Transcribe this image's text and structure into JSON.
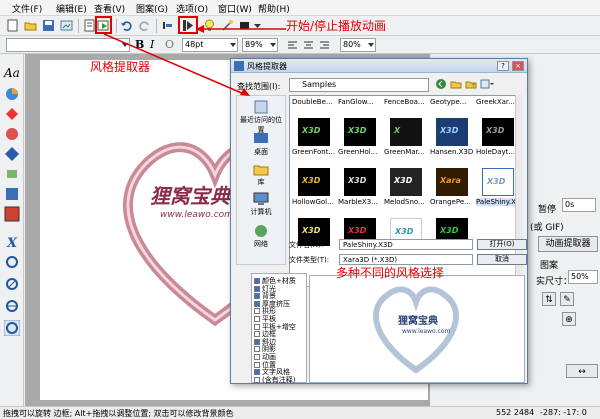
{
  "menu": [
    {
      "label": "文件(F)"
    },
    {
      "label": "编辑(E)"
    },
    {
      "label": "查看(V)"
    },
    {
      "label": "图案(G)"
    },
    {
      "label": "选项(O)"
    },
    {
      "label": "窗口(W)"
    },
    {
      "label": "帮助(H)"
    }
  ],
  "toolbar2": {
    "font_size": "48pt",
    "zoom1": "89%",
    "zoom2": "80%",
    "bold": "B",
    "italic": "I",
    "outline": "O"
  },
  "annotations": {
    "play_anim": "开始/停止播放动画",
    "style_picker": "风格提取器",
    "many_styles": "多种不同的风格选择"
  },
  "dialog": {
    "title": "风格提取器",
    "look_in_label": "查找范围(I):",
    "look_in_value": "Samples",
    "places": [
      {
        "label": "最近访问的位置"
      },
      {
        "label": "桌面"
      },
      {
        "label": "库"
      },
      {
        "label": "计算机"
      },
      {
        "label": "网络"
      }
    ],
    "rows": [
      [
        "DoubleBe...",
        "FanGlow...",
        "FenceBoa...",
        "Geotype...",
        "GreekXar..."
      ],
      [
        "GreenFont...",
        "GreenHol...",
        "GreenMar...",
        "Hansen.X3D",
        "HoleDayt..."
      ],
      [
        "HollowGol...",
        "MarbleX3...",
        "MelodSno...",
        "OrangePe...",
        "PaleShiny.X3D"
      ]
    ],
    "filename_label": "文件名(N):",
    "filename_value": "PaleShiny.X3D",
    "filetype_label": "文件类型(T):",
    "filetype_value": "Xara3D (*.X3D)",
    "open_btn": "打开(O)",
    "cancel_btn": "取消",
    "options": [
      {
        "label": "颜色+材质",
        "checked": true
      },
      {
        "label": "灯光",
        "checked": true
      },
      {
        "label": "背景",
        "checked": true
      },
      {
        "label": "厚度挤压",
        "checked": true
      },
      {
        "label": "拱形",
        "checked": false
      },
      {
        "label": "平板",
        "checked": false
      },
      {
        "label": "平板+增空",
        "checked": false
      },
      {
        "label": "边框",
        "checked": false
      },
      {
        "label": "斜边",
        "checked": true
      },
      {
        "label": "阴影",
        "checked": false
      },
      {
        "label": "动画",
        "checked": false
      },
      {
        "label": "位置",
        "checked": false
      },
      {
        "label": "文字风格",
        "checked": true
      },
      {
        "label": "(含有注释)",
        "checked": false
      }
    ]
  },
  "rightpanel": {
    "time_label": "暂停",
    "time_value": "0s",
    "gif_label": "(或 GIF)",
    "anim_btn": "动画提取器",
    "pattern_label": "图案",
    "size_label": "实尺寸：",
    "size_value": "50%"
  },
  "canvas_text": {
    "logo_cn": "狸窝宝典",
    "logo_url": "www.leawo.com"
  },
  "statusbar": {
    "hint": "拖拽可以旋转 边框; Alt+拖拽以调整位置; 双击可以修改背景颜色",
    "coords": "552 2484",
    "angle": "-287: -17: 0"
  }
}
